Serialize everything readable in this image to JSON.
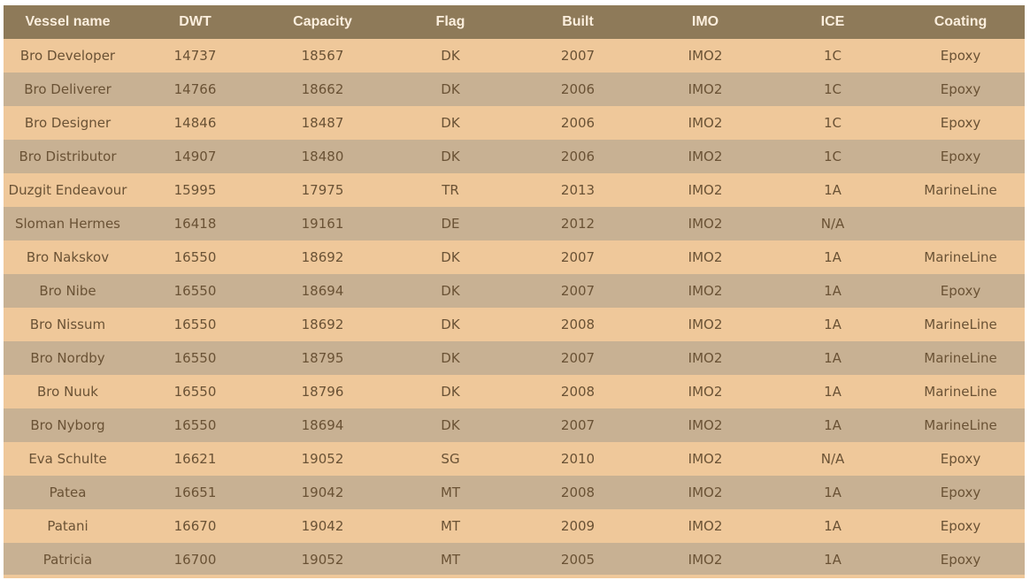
{
  "table": {
    "columns": [
      "Vessel name",
      "DWT",
      "Capacity",
      "Flag",
      "Built",
      "IMO",
      "ICE",
      "Coating"
    ],
    "rows": [
      [
        "Bro Developer",
        "14737",
        "18567",
        "DK",
        "2007",
        "IMO2",
        "1C",
        "Epoxy"
      ],
      [
        "Bro Deliverer",
        "14766",
        "18662",
        "DK",
        "2006",
        "IMO2",
        "1C",
        "Epoxy"
      ],
      [
        "Bro Designer",
        "14846",
        "18487",
        "DK",
        "2006",
        "IMO2",
        "1C",
        "Epoxy"
      ],
      [
        "Bro Distributor",
        "14907",
        "18480",
        "DK",
        "2006",
        "IMO2",
        "1C",
        "Epoxy"
      ],
      [
        "Duzgit Endeavour",
        "15995",
        "17975",
        "TR",
        "2013",
        "IMO2",
        "1A",
        "MarineLine"
      ],
      [
        "Sloman Hermes",
        "16418",
        "19161",
        "DE",
        "2012",
        "IMO2",
        "N/A",
        ""
      ],
      [
        "Bro Nakskov",
        "16550",
        "18692",
        "DK",
        "2007",
        "IMO2",
        "1A",
        "MarineLine"
      ],
      [
        "Bro Nibe",
        "16550",
        "18694",
        "DK",
        "2007",
        "IMO2",
        "1A",
        "Epoxy"
      ],
      [
        "Bro Nissum",
        "16550",
        "18692",
        "DK",
        "2008",
        "IMO2",
        "1A",
        "MarineLine"
      ],
      [
        "Bro Nordby",
        "16550",
        "18795",
        "DK",
        "2007",
        "IMO2",
        "1A",
        "MarineLine"
      ],
      [
        "Bro Nuuk",
        "16550",
        "18796",
        "DK",
        "2008",
        "IMO2",
        "1A",
        "MarineLine"
      ],
      [
        "Bro Nyborg",
        "16550",
        "18694",
        "DK",
        "2007",
        "IMO2",
        "1A",
        "MarineLine"
      ],
      [
        "Eva Schulte",
        "16621",
        "19052",
        "SG",
        "2010",
        "IMO2",
        "N/A",
        "Epoxy"
      ],
      [
        "Patea",
        "16651",
        "19042",
        "MT",
        "2008",
        "IMO2",
        "1A",
        "Epoxy"
      ],
      [
        "Patani",
        "16670",
        "19042",
        "MT",
        "2009",
        "IMO2",
        "1A",
        "Epoxy"
      ],
      [
        "Patricia",
        "16700",
        "19052",
        "MT",
        "2005",
        "IMO2",
        "1A",
        "Epoxy"
      ]
    ]
  },
  "colors": {
    "header_bg": "#8e7a59",
    "row_light": "#efc89a",
    "row_dark": "#c8b193",
    "text": "#6a5235"
  }
}
